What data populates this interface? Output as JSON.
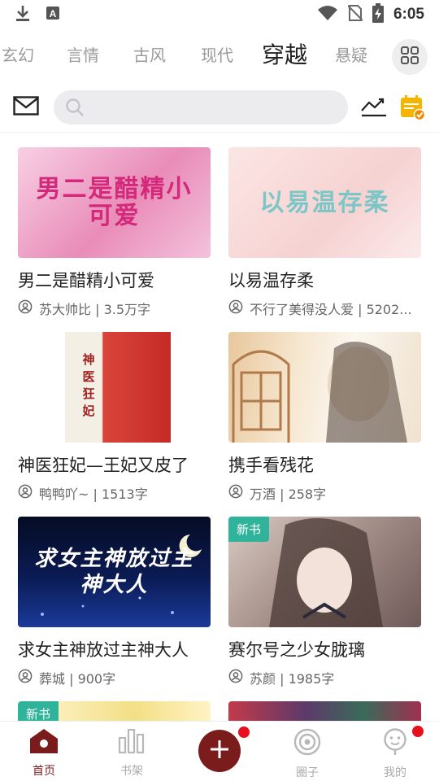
{
  "status_bar": {
    "time": "6:05",
    "icons": [
      "download-icon",
      "text-a-icon",
      "wifi-icon",
      "no-sim-icon",
      "battery-charging-icon"
    ]
  },
  "tabs": [
    {
      "label": "玄幻",
      "active": false
    },
    {
      "label": "言情",
      "active": false
    },
    {
      "label": "古风",
      "active": false
    },
    {
      "label": "现代",
      "active": false
    },
    {
      "label": "穿越",
      "active": true
    },
    {
      "label": "悬疑",
      "active": false
    }
  ],
  "search": {
    "placeholder": "",
    "value": ""
  },
  "books": [
    {
      "title": "男二是醋精小可爱",
      "meta": "苏大帅比 | 3.5万字",
      "cover_text": "男二是醋精小可爱",
      "badge": "",
      "cover_bg": "#f2b6d2",
      "cover_fg": "#d4287a"
    },
    {
      "title": "以易温存柔",
      "meta": "不行了美得没人爱 | 5202...",
      "cover_text": "以易温存柔",
      "badge": "",
      "cover_bg": "#f8dcdc",
      "cover_fg": "#7cc6c6"
    },
    {
      "title": "神医狂妃—王妃又皮了",
      "meta": "鸭鸭吖~ | 1513字",
      "cover_text": "神医狂妃",
      "badge": "",
      "cover_bg": "#d94a3c",
      "cover_fg": "#ffffff"
    },
    {
      "title": "携手看残花",
      "meta": "万酒 | 258字",
      "cover_text": "",
      "badge": "",
      "cover_bg": "#f1dcc2",
      "cover_fg": "#6b4a2a"
    },
    {
      "title": "求女主神放过主神大人",
      "meta": "葬城 | 900字",
      "cover_text": "求女主神放过主神大人",
      "badge": "",
      "cover_bg": "#07153a",
      "cover_fg": "#ffffff"
    },
    {
      "title": "赛尔号之少女胧璃",
      "meta": "苏颜 | 1985字",
      "cover_text": "",
      "badge": "新书",
      "cover_bg": "#8f7b78",
      "cover_fg": "#ffffff"
    }
  ],
  "partial_books": [
    {
      "badge": "新书",
      "cover_bg": "#f4e6a2"
    },
    {
      "badge": "",
      "cover_bg": "#6a3a5a"
    }
  ],
  "bottom_nav": [
    {
      "label": "首页",
      "icon": "home-icon",
      "active": true
    },
    {
      "label": "书架",
      "icon": "bookshelf-icon",
      "active": false
    },
    {
      "label": "",
      "icon": "plus-icon",
      "active": false
    },
    {
      "label": "圈子",
      "icon": "circle-target-icon",
      "active": false
    },
    {
      "label": "我的",
      "icon": "profile-face-icon",
      "active": false
    }
  ],
  "colors": {
    "accent": "#7a1c1c",
    "badge": "#2fb39a",
    "notification_dot": "#e8101c",
    "calendar": "#f5b400"
  }
}
